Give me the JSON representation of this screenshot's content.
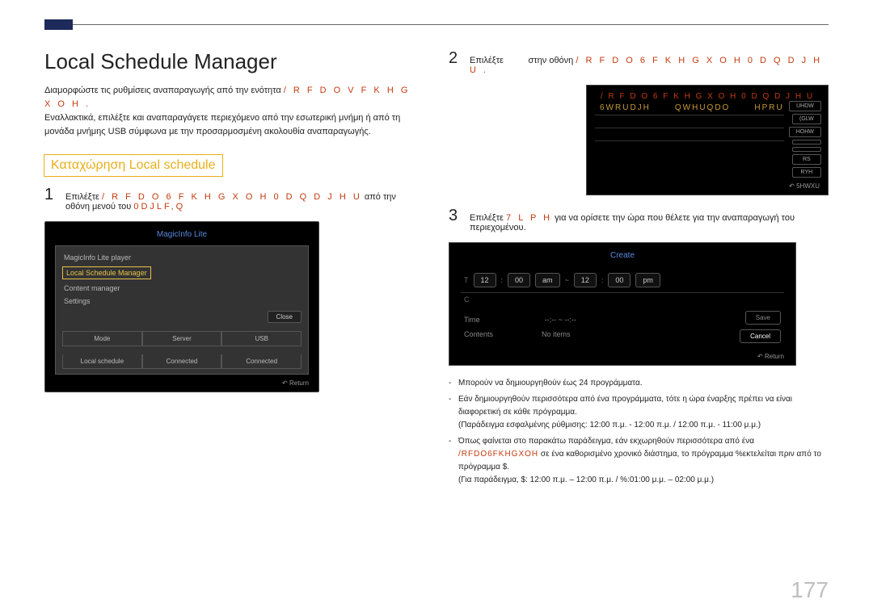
{
  "page_number": "177",
  "header": {
    "title": "Local Schedule Manager",
    "para1_a": "Διαμορφώστε τις ρυθμίσεις αναπαραγωγής από την ενότητα ",
    "para1_glitch": "/ R F D O  V F K H G X O H .",
    "para2": "Εναλλακτικά, επιλέξτε και αναπαραγάγετε περιεχόμενο από την εσωτερική μνήμη ή από τη μονάδα μνήμης USB σύμφωνα με την προσαρμοσμένη ακολουθία αναπαραγωγής.",
    "sub_heading": "Καταχώρηση Local schedule"
  },
  "left": {
    "step1_label": "1",
    "step1_a": "Επιλέξτε ",
    "step1_glitch": "/ R F D O  6 F K H G X O H  0 D Q D J H U",
    "step1_b": " από την οθόνη μενού του ",
    "step1_glitch2": "0DJLF,Q"
  },
  "sc1": {
    "title": "MagicInfo Lite",
    "item0": "MagicInfo Lite player",
    "item1": "Local Schedule Manager",
    "item2": "Content manager",
    "item3": "Settings",
    "close": "Close",
    "g1a": "Mode",
    "g1b": "Server",
    "g1c": "USB",
    "g2a": "Local schedule",
    "g2b": "Connected",
    "g2c": "Connected",
    "return": "Return"
  },
  "right": {
    "step2_num": "2",
    "step2_a": "Επιλέξτε",
    "step2_b": "στην οθόνη ",
    "step2_glitch": "/ R F D O  6 F K H G X O H  0 D Q D J H U .",
    "step3_num": "3",
    "step3_a": "Επιλέξτε ",
    "step3_glitch": "7 L P H",
    "step3_b": " για να ορίσετε την ώρα που θέλετε για την αναπαραγωγή του περιεχομένου."
  },
  "sc2": {
    "header_left_glitch": "/ R F D O  6 F K H G X O H  0 D Q D J H U",
    "row1a": "6WRUDJH",
    "row1b": "QWHUQDO",
    "row1c": "HPRU",
    "btns": [
      "UHDW",
      "(GLW",
      "HOHW",
      "",
      "",
      "RS",
      "RYH",
      "5HWXU"
    ],
    "return": "5HWXU"
  },
  "sc3": {
    "title": "Create",
    "h1": "12",
    "h2": "00",
    "ampm1": "am",
    "tilde": "~",
    "h3": "12",
    "h4": "00",
    "ampm2": "pm",
    "r1a": "Time",
    "r1b": "--:-- ~ --:--",
    "r2a": "Contents",
    "r2b": "No items",
    "save": "Save",
    "cancel": "Cancel",
    "return": "Return"
  },
  "notes": {
    "n1": "Μπορούν να δημιουργηθούν έως 24 προγράμματα.",
    "n2": "Εάν δημιουργηθούν περισσότερα από ένα προγράμματα, τότε η ώρα έναρξης πρέπει να είναι διαφορετική σε κάθε πρόγραμμα.",
    "n2_sub": "(Παράδειγμα εσφαλμένης ρύθμισης: 12:00 π.μ. - 12:00 π.μ. / 12:00 π.μ. - 11:00 μ.μ.)",
    "n3_a": "Όπως φαίνεται στο παρακάτω παράδειγμα, εάν εκχωρηθούν περισσότερα από ένα ",
    "n3_glitch": "/RFDO6FKHGXOH",
    "n3_b": " σε ένα καθορισμένο χρονικό διάστημα, το πρόγραμμα %εκτελείται πριν από το πρόγραμμα $.",
    "n3_sub": "(Για παράδειγμα, $: 12:00 π.μ. – 12:00 π.μ. / %:01:00 μ.μ. – 02:00 μ.μ.)"
  }
}
